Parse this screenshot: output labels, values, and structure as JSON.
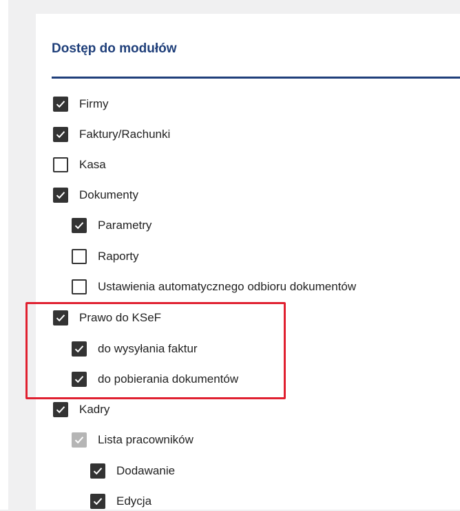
{
  "section": {
    "title": "Dostęp do modułów"
  },
  "items": [
    {
      "label": "Firmy",
      "state": "checked"
    },
    {
      "label": "Faktury/Rachunki",
      "state": "checked"
    },
    {
      "label": "Kasa",
      "state": "unchecked"
    },
    {
      "label": "Dokumenty",
      "state": "checked"
    },
    {
      "label": "Parametry",
      "state": "checked"
    },
    {
      "label": "Raporty",
      "state": "unchecked"
    },
    {
      "label": "Ustawienia automatycznego odbioru dokumentów",
      "state": "unchecked"
    },
    {
      "label": "Prawo do KSeF",
      "state": "checked"
    },
    {
      "label": "do wysyłania faktur",
      "state": "checked"
    },
    {
      "label": "do pobierania dokumentów",
      "state": "checked"
    },
    {
      "label": "Kadry",
      "state": "checked"
    },
    {
      "label": "Lista pracowników",
      "state": "checked-disabled"
    },
    {
      "label": "Dodawanie",
      "state": "checked"
    },
    {
      "label": "Edycja",
      "state": "checked"
    }
  ],
  "colors": {
    "title": "#1f3f7a",
    "checkbox": "#333333",
    "checkbox_disabled": "#b5b5b5",
    "highlight": "#e02030"
  }
}
